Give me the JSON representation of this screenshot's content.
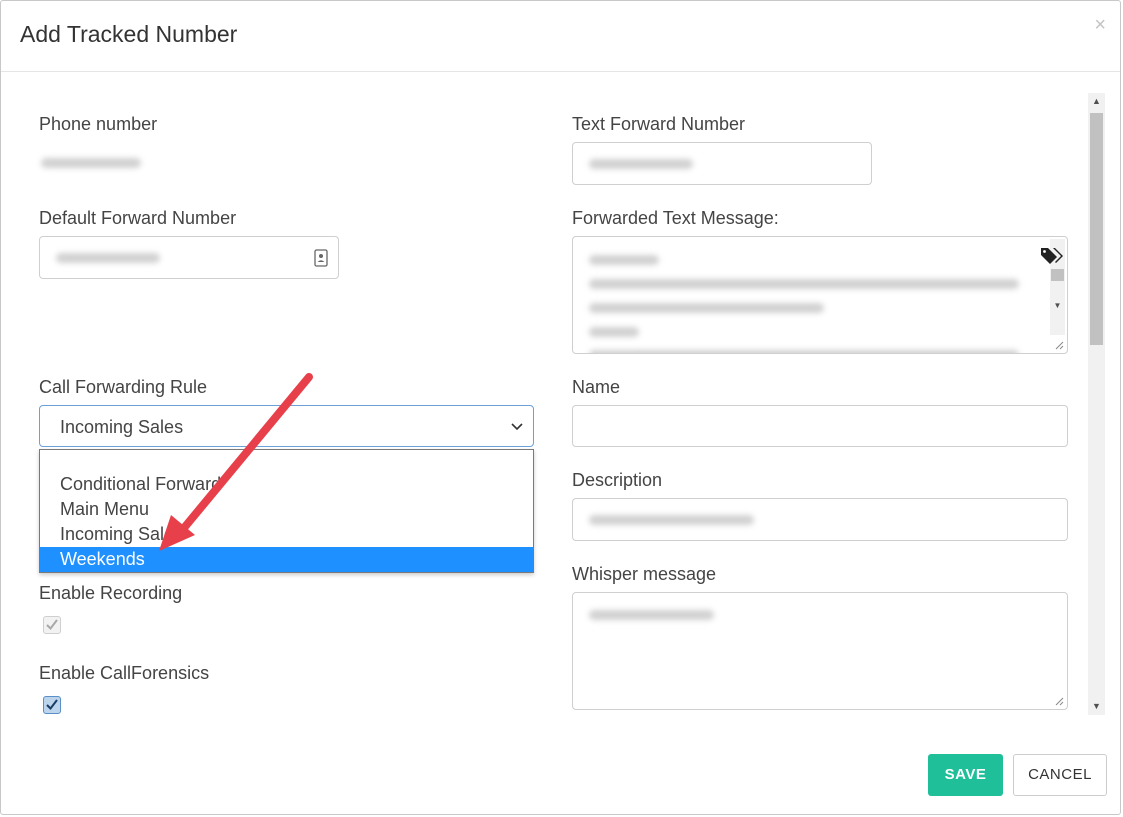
{
  "modal": {
    "title": "Add Tracked Number",
    "close_glyph": "×"
  },
  "form": {
    "phone_number_label": "Phone number",
    "text_forward_number_label": "Text Forward Number",
    "default_forward_number_label": "Default Forward Number",
    "forwarded_text_message_label": "Forwarded Text Message:",
    "call_forwarding_rule_label": "Call Forwarding Rule",
    "call_forwarding_rule_value": "Incoming Sales",
    "call_forwarding_rule_options": [
      "Conditional Forward",
      "Main Menu",
      "Incoming Sales",
      "Weekends"
    ],
    "name_label": "Name",
    "name_value": "",
    "description_label": "Description",
    "whisper_message_label": "Whisper message",
    "enable_recording_label": "Enable Recording",
    "enable_callforensics_label": "Enable CallForensics"
  },
  "buttons": {
    "save_label": "SAVE",
    "cancel_label": "CANCEL"
  },
  "colors": {
    "save_button": "#1fbf9a",
    "selected_option": "#1e90ff",
    "annotation_arrow": "#e8404a"
  },
  "icons": {
    "contact_book": "contact-book-icon",
    "tags": "tags-icon",
    "chevron": "chevron-down-icon"
  }
}
